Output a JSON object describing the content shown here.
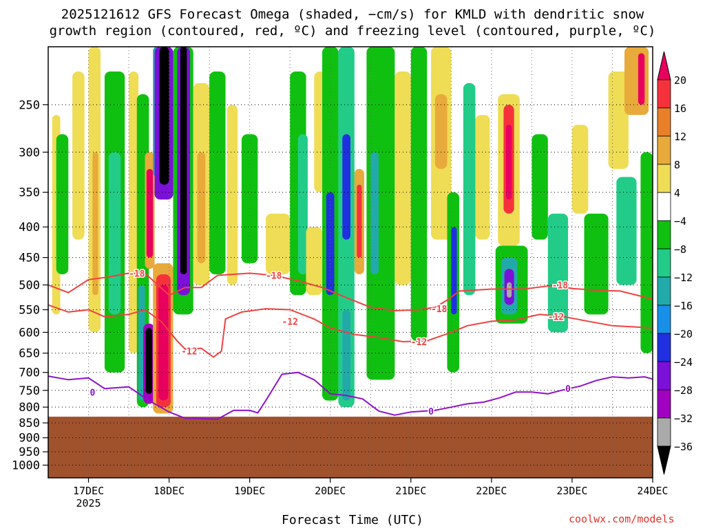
{
  "chart_data": {
    "type": "heatmap",
    "title_line1": "2025121612 GFS Forecast Omega (shaded, −cm/s) for KMLD with dendritic snow",
    "title_line2": "growth region (contoured, red, ºC) and freezing level (contoured, purple, ºC)",
    "xlabel": "Forecast Time (UTC)",
    "credit": "coolwx.com/models",
    "x_ticks": [
      "17DEC",
      "18DEC",
      "19DEC",
      "20DEC",
      "21DEC",
      "22DEC",
      "23DEC",
      "24DEC"
    ],
    "x_year_label": "2025",
    "x_range": [
      16.5,
      24.0
    ],
    "y_ticks": [
      250,
      300,
      350,
      400,
      450,
      500,
      550,
      600,
      650,
      700,
      750,
      800,
      850,
      900,
      950,
      1000
    ],
    "y_range": [
      200,
      1050
    ],
    "y_scale": "log",
    "colorbar_ticks": [
      "20",
      "16",
      "12",
      "8",
      "4",
      "−4",
      "−8",
      "−12",
      "−16",
      "−20",
      "−24",
      "−28",
      "−32",
      "−36"
    ],
    "colorbar_colors": [
      "#e8005f",
      "#f5323c",
      "#e8802a",
      "#e8aa3a",
      "#eedd55",
      "#ffffff",
      "#10c010",
      "#22cc88",
      "#22aaaa",
      "#1890e8",
      "#2030e0",
      "#7b10d8",
      "#a000c0",
      "#aaaaaa",
      "#000000"
    ],
    "ground_color": "#a0522d",
    "ground_top_pressure": 830,
    "contour_labels": {
      "dgz_upper": "-18",
      "dgz_lower": "-12",
      "freezing": "0"
    },
    "dgz_upper_line": [
      [
        16.5,
        500
      ],
      [
        16.75,
        515
      ],
      [
        17.0,
        490
      ],
      [
        17.25,
        485
      ],
      [
        17.5,
        478
      ],
      [
        17.7,
        478
      ],
      [
        18.0,
        520
      ],
      [
        18.2,
        505
      ],
      [
        18.4,
        505
      ],
      [
        18.6,
        482
      ],
      [
        19.0,
        478
      ],
      [
        19.3,
        482
      ],
      [
        19.6,
        492
      ],
      [
        19.9,
        505
      ],
      [
        20.2,
        525
      ],
      [
        20.5,
        545
      ],
      [
        20.8,
        552
      ],
      [
        21.1,
        550
      ],
      [
        21.3,
        545
      ],
      [
        21.45,
        530
      ],
      [
        21.6,
        512
      ],
      [
        22.0,
        508
      ],
      [
        22.4,
        508
      ],
      [
        22.8,
        500
      ],
      [
        23.0,
        507
      ],
      [
        23.3,
        510
      ],
      [
        23.6,
        512
      ],
      [
        24.0,
        528
      ]
    ],
    "dgz_lower_line": [
      [
        16.5,
        540
      ],
      [
        16.75,
        555
      ],
      [
        17.0,
        550
      ],
      [
        17.2,
        565
      ],
      [
        17.5,
        560
      ],
      [
        17.7,
        550
      ],
      [
        17.9,
        575
      ],
      [
        18.1,
        620
      ],
      [
        18.2,
        640
      ],
      [
        18.4,
        638
      ],
      [
        18.55,
        660
      ],
      [
        18.65,
        645
      ],
      [
        18.7,
        570
      ],
      [
        18.9,
        555
      ],
      [
        19.2,
        548
      ],
      [
        19.5,
        550
      ],
      [
        19.8,
        570
      ],
      [
        20.0,
        590
      ],
      [
        20.3,
        605
      ],
      [
        20.6,
        612
      ],
      [
        20.9,
        622
      ],
      [
        21.2,
        620
      ],
      [
        21.5,
        600
      ],
      [
        21.7,
        585
      ],
      [
        22.0,
        575
      ],
      [
        22.3,
        572
      ],
      [
        22.6,
        560
      ],
      [
        22.9,
        565
      ],
      [
        23.2,
        575
      ],
      [
        23.5,
        585
      ],
      [
        24.0,
        590
      ]
    ],
    "freezing_line": [
      [
        16.5,
        710
      ],
      [
        16.75,
        720
      ],
      [
        17.0,
        715
      ],
      [
        17.2,
        745
      ],
      [
        17.5,
        740
      ],
      [
        17.75,
        780
      ],
      [
        18.0,
        815
      ],
      [
        18.2,
        835
      ],
      [
        18.3,
        835
      ],
      [
        18.6,
        838
      ],
      [
        18.8,
        810
      ],
      [
        19.0,
        810
      ],
      [
        19.1,
        818
      ],
      [
        19.2,
        780
      ],
      [
        19.4,
        705
      ],
      [
        19.6,
        700
      ],
      [
        19.8,
        720
      ],
      [
        20.0,
        760
      ],
      [
        20.2,
        765
      ],
      [
        20.4,
        775
      ],
      [
        20.6,
        812
      ],
      [
        20.8,
        825
      ],
      [
        21.0,
        815
      ],
      [
        21.3,
        810
      ],
      [
        21.5,
        800
      ],
      [
        21.7,
        790
      ],
      [
        21.9,
        785
      ],
      [
        22.1,
        772
      ],
      [
        22.3,
        755
      ],
      [
        22.5,
        755
      ],
      [
        22.7,
        760
      ],
      [
        22.9,
        748
      ],
      [
        23.1,
        738
      ],
      [
        23.3,
        722
      ],
      [
        23.5,
        712
      ],
      [
        23.7,
        715
      ],
      [
        23.9,
        712
      ],
      [
        24.0,
        718
      ]
    ],
    "shaded_cells": [
      {
        "x0": 16.55,
        "x1": 16.65,
        "p0": 260,
        "p1": 560,
        "c": "#eedd55"
      },
      {
        "x0": 16.6,
        "x1": 16.75,
        "p0": 280,
        "p1": 480,
        "c": "#10c010"
      },
      {
        "x0": 16.8,
        "x1": 16.95,
        "p0": 220,
        "p1": 420,
        "c": "#eedd55"
      },
      {
        "x0": 17.0,
        "x1": 17.15,
        "p0": 200,
        "p1": 600,
        "c": "#eedd55"
      },
      {
        "x0": 17.05,
        "x1": 17.12,
        "p0": 300,
        "p1": 520,
        "c": "#e8aa3a"
      },
      {
        "x0": 17.2,
        "x1": 17.45,
        "p0": 220,
        "p1": 700,
        "c": "#10c010"
      },
      {
        "x0": 17.25,
        "x1": 17.4,
        "p0": 300,
        "p1": 560,
        "c": "#22cc88"
      },
      {
        "x0": 17.5,
        "x1": 17.62,
        "p0": 220,
        "p1": 650,
        "c": "#eedd55"
      },
      {
        "x0": 17.6,
        "x1": 17.75,
        "p0": 240,
        "p1": 800,
        "c": "#10c010"
      },
      {
        "x0": 17.62,
        "x1": 17.7,
        "p0": 500,
        "p1": 780,
        "c": "#22aaaa"
      },
      {
        "x0": 17.7,
        "x1": 17.82,
        "p0": 300,
        "p1": 470,
        "c": "#e8aa3a"
      },
      {
        "x0": 17.72,
        "x1": 17.8,
        "p0": 320,
        "p1": 450,
        "c": "#e8005f"
      },
      {
        "x0": 17.68,
        "x1": 17.82,
        "p0": 580,
        "p1": 790,
        "c": "#a000c0"
      },
      {
        "x0": 17.71,
        "x1": 17.79,
        "p0": 590,
        "p1": 760,
        "c": "#000000"
      },
      {
        "x0": 17.8,
        "x1": 18.05,
        "p0": 460,
        "p1": 820,
        "c": "#e8aa3a"
      },
      {
        "x0": 17.84,
        "x1": 18.02,
        "p0": 480,
        "p1": 800,
        "c": "#f5323c"
      },
      {
        "x0": 17.87,
        "x1": 17.99,
        "p0": 500,
        "p1": 780,
        "c": "#e8005f"
      },
      {
        "x0": 17.8,
        "x1": 17.9,
        "p0": 200,
        "p1": 330,
        "c": "#22aaaa"
      },
      {
        "x0": 17.82,
        "x1": 18.05,
        "p0": 200,
        "p1": 360,
        "c": "#7b10d8"
      },
      {
        "x0": 17.88,
        "x1": 18.0,
        "p0": 200,
        "p1": 340,
        "c": "#000000"
      },
      {
        "x0": 18.05,
        "x1": 18.3,
        "p0": 200,
        "p1": 560,
        "c": "#10c010"
      },
      {
        "x0": 18.1,
        "x1": 18.26,
        "p0": 200,
        "p1": 520,
        "c": "#7b10d8"
      },
      {
        "x0": 18.14,
        "x1": 18.22,
        "p0": 200,
        "p1": 480,
        "c": "#000000"
      },
      {
        "x0": 18.3,
        "x1": 18.5,
        "p0": 230,
        "p1": 500,
        "c": "#eedd55"
      },
      {
        "x0": 18.35,
        "x1": 18.45,
        "p0": 300,
        "p1": 460,
        "c": "#e8aa3a"
      },
      {
        "x0": 18.5,
        "x1": 18.7,
        "p0": 220,
        "p1": 480,
        "c": "#10c010"
      },
      {
        "x0": 18.72,
        "x1": 18.85,
        "p0": 250,
        "p1": 500,
        "c": "#eedd55"
      },
      {
        "x0": 18.9,
        "x1": 19.1,
        "p0": 280,
        "p1": 460,
        "c": "#10c010"
      },
      {
        "x0": 19.2,
        "x1": 19.5,
        "p0": 380,
        "p1": 480,
        "c": "#eedd55"
      },
      {
        "x0": 19.5,
        "x1": 19.7,
        "p0": 220,
        "p1": 520,
        "c": "#10c010"
      },
      {
        "x0": 19.6,
        "x1": 19.72,
        "p0": 280,
        "p1": 480,
        "c": "#22cc88"
      },
      {
        "x0": 19.8,
        "x1": 19.95,
        "p0": 220,
        "p1": 350,
        "c": "#eedd55"
      },
      {
        "x0": 19.7,
        "x1": 19.9,
        "p0": 400,
        "p1": 520,
        "c": "#eedd55"
      },
      {
        "x0": 19.9,
        "x1": 20.1,
        "p0": 200,
        "p1": 780,
        "c": "#10c010"
      },
      {
        "x0": 19.95,
        "x1": 20.05,
        "p0": 350,
        "p1": 520,
        "c": "#2030e0"
      },
      {
        "x0": 20.1,
        "x1": 20.3,
        "p0": 200,
        "p1": 800,
        "c": "#22cc88"
      },
      {
        "x0": 20.15,
        "x1": 20.25,
        "p0": 280,
        "p1": 420,
        "c": "#2030e0"
      },
      {
        "x0": 20.15,
        "x1": 20.25,
        "p0": 550,
        "p1": 780,
        "c": "#22aaaa"
      },
      {
        "x0": 20.3,
        "x1": 20.42,
        "p0": 320,
        "p1": 480,
        "c": "#e8aa3a"
      },
      {
        "x0": 20.33,
        "x1": 20.39,
        "p0": 340,
        "p1": 450,
        "c": "#f5323c"
      },
      {
        "x0": 20.45,
        "x1": 20.8,
        "p0": 200,
        "p1": 720,
        "c": "#10c010"
      },
      {
        "x0": 20.5,
        "x1": 20.6,
        "p0": 300,
        "p1": 480,
        "c": "#22aaaa"
      },
      {
        "x0": 20.8,
        "x1": 21.0,
        "p0": 220,
        "p1": 500,
        "c": "#eedd55"
      },
      {
        "x0": 21.0,
        "x1": 21.2,
        "p0": 200,
        "p1": 620,
        "c": "#10c010"
      },
      {
        "x0": 21.25,
        "x1": 21.5,
        "p0": 200,
        "p1": 420,
        "c": "#eedd55"
      },
      {
        "x0": 21.3,
        "x1": 21.45,
        "p0": 240,
        "p1": 320,
        "c": "#e8aa3a"
      },
      {
        "x0": 21.45,
        "x1": 21.6,
        "p0": 350,
        "p1": 700,
        "c": "#10c010"
      },
      {
        "x0": 21.5,
        "x1": 21.57,
        "p0": 400,
        "p1": 560,
        "c": "#2030e0"
      },
      {
        "x0": 21.65,
        "x1": 21.8,
        "p0": 230,
        "p1": 520,
        "c": "#22cc88"
      },
      {
        "x0": 21.8,
        "x1": 21.98,
        "p0": 260,
        "p1": 420,
        "c": "#eedd55"
      },
      {
        "x0": 22.08,
        "x1": 22.35,
        "p0": 240,
        "p1": 430,
        "c": "#eedd55"
      },
      {
        "x0": 22.15,
        "x1": 22.28,
        "p0": 250,
        "p1": 380,
        "c": "#f5323c"
      },
      {
        "x0": 22.18,
        "x1": 22.25,
        "p0": 270,
        "p1": 360,
        "c": "#e8005f"
      },
      {
        "x0": 22.05,
        "x1": 22.45,
        "p0": 430,
        "p1": 580,
        "c": "#10c010"
      },
      {
        "x0": 22.12,
        "x1": 22.32,
        "p0": 450,
        "p1": 560,
        "c": "#22aaaa"
      },
      {
        "x0": 22.16,
        "x1": 22.28,
        "p0": 470,
        "p1": 540,
        "c": "#7b10d8"
      },
      {
        "x0": 22.19,
        "x1": 22.25,
        "p0": 495,
        "p1": 525,
        "c": "#aaaaaa"
      },
      {
        "x0": 22.5,
        "x1": 22.7,
        "p0": 280,
        "p1": 420,
        "c": "#10c010"
      },
      {
        "x0": 22.7,
        "x1": 22.95,
        "p0": 380,
        "p1": 600,
        "c": "#22cc88"
      },
      {
        "x0": 23.0,
        "x1": 23.2,
        "p0": 270,
        "p1": 380,
        "c": "#eedd55"
      },
      {
        "x0": 23.15,
        "x1": 23.45,
        "p0": 380,
        "p1": 560,
        "c": "#10c010"
      },
      {
        "x0": 23.45,
        "x1": 23.7,
        "p0": 220,
        "p1": 320,
        "c": "#eedd55"
      },
      {
        "x0": 23.55,
        "x1": 23.8,
        "p0": 330,
        "p1": 500,
        "c": "#22cc88"
      },
      {
        "x0": 23.65,
        "x1": 23.95,
        "p0": 200,
        "p1": 260,
        "c": "#e8aa3a"
      },
      {
        "x0": 23.82,
        "x1": 23.9,
        "p0": 205,
        "p1": 250,
        "c": "#e8005f"
      },
      {
        "x0": 23.85,
        "x1": 24.0,
        "p0": 300,
        "p1": 650,
        "c": "#10c010"
      }
    ]
  }
}
